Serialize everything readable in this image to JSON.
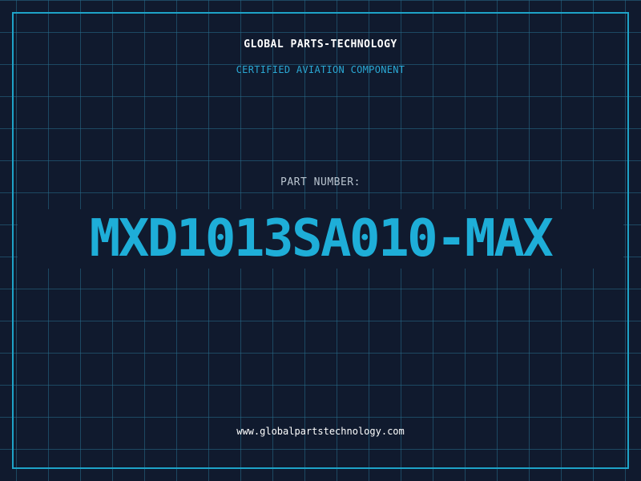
{
  "header": {
    "company": "GLOBAL PARTS-TECHNOLOGY",
    "subtitle": "CERTIFIED AVIATION COMPONENT"
  },
  "part": {
    "label": "PART NUMBER:",
    "number": "MXD1013SA010-MAX"
  },
  "footer": {
    "website": "www.globalpartstechnology.com"
  },
  "colors": {
    "background": "#101a2e",
    "grid": "#286e8c",
    "accent": "#1eaed8",
    "text": "#ffffff"
  }
}
